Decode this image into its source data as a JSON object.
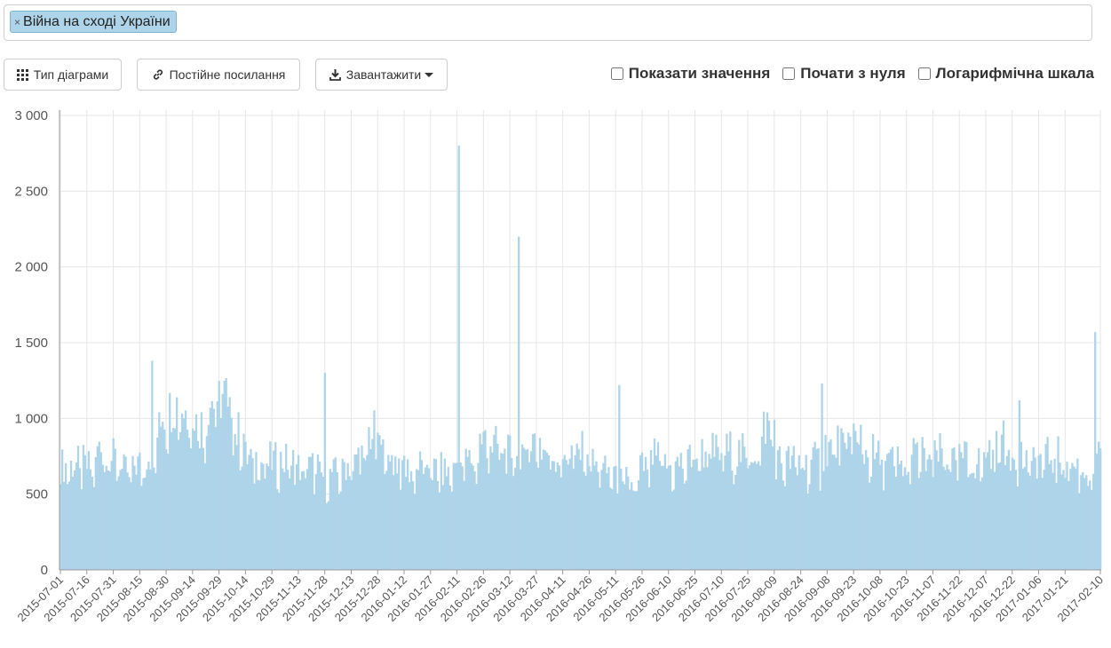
{
  "filter": {
    "tag_label": "Війна на сході України",
    "remove_glyph": "×"
  },
  "toolbar": {
    "chart_type_label": "Тип діаграми",
    "permalink_label": "Постійне посилання",
    "download_label": "Завантажити"
  },
  "options": {
    "show_values_label": "Показати значення",
    "start_zero_label": "Почати з нуля",
    "log_scale_label": "Логарифмічна шкала",
    "show_values_checked": false,
    "start_zero_checked": false,
    "log_scale_checked": false
  },
  "colors": {
    "bar": "#aed4ea",
    "grid": "#e6e6e6",
    "axis": "#999999"
  },
  "chart_data": {
    "type": "bar",
    "title": "",
    "xlabel": "",
    "ylabel": "",
    "ylim": [
      0,
      3000
    ],
    "yticks": [
      0,
      500,
      1000,
      1500,
      2000,
      2500,
      3000
    ],
    "ytick_labels": [
      "0",
      "500",
      "1 000",
      "1 500",
      "2 000",
      "2 500",
      "3 000"
    ],
    "grid": true,
    "legend": "none",
    "start_date": "2015-07-01",
    "end_date": "2017-02-10",
    "xtick_labels": [
      "2015-07-01",
      "2015-07-16",
      "2015-07-31",
      "2015-08-15",
      "2015-08-30",
      "2015-09-14",
      "2015-09-29",
      "2015-10-14",
      "2015-10-29",
      "2015-11-13",
      "2015-11-28",
      "2015-12-13",
      "2015-12-28",
      "2016-01-12",
      "2016-01-27",
      "2016-02-11",
      "2016-02-26",
      "2016-03-12",
      "2016-03-27",
      "2016-04-11",
      "2016-04-26",
      "2016-05-11",
      "2016-05-26",
      "2016-06-10",
      "2016-06-25",
      "2016-07-10",
      "2016-07-25",
      "2016-08-09",
      "2016-08-24",
      "2016-09-08",
      "2016-09-23",
      "2016-10-08",
      "2016-10-23",
      "2016-11-07",
      "2016-11-22",
      "2016-12-07",
      "2016-12-22",
      "2017-01-06",
      "2017-01-21",
      "2017-02-10"
    ],
    "weekly_values": [
      690,
      700,
      680,
      800,
      740,
      650,
      700,
      770,
      1050,
      1100,
      1050,
      960,
      1120,
      1150,
      900,
      740,
      710,
      720,
      720,
      680,
      680,
      620,
      640,
      700,
      760,
      900,
      770,
      720,
      660,
      690,
      660,
      650,
      710,
      730,
      860,
      820,
      760,
      800,
      860,
      790,
      750,
      770,
      780,
      700,
      650,
      590,
      560,
      680,
      740,
      680,
      700,
      760,
      780,
      780,
      790,
      770,
      790,
      960,
      720,
      720,
      700,
      720,
      820,
      830,
      900,
      770,
      740,
      720,
      680,
      760,
      730,
      770,
      720,
      740,
      710,
      800,
      840,
      780,
      710,
      730,
      750,
      720,
      680,
      640,
      720,
      760,
      720,
      710,
      720,
      630,
      560,
      540,
      560,
      560,
      620,
      560,
      570,
      560,
      540,
      530,
      580,
      570,
      580,
      760,
      700,
      600,
      560,
      560,
      560,
      560,
      550,
      540,
      520,
      620,
      620,
      740,
      680,
      660,
      620,
      640,
      640,
      620,
      690,
      700,
      710,
      760,
      790,
      860,
      800,
      860,
      920,
      820,
      620,
      710,
      760,
      870,
      880,
      860,
      840,
      1250,
      960
    ],
    "spikes": [
      {
        "date": "2015-08-22",
        "value": 1380
      },
      {
        "date": "2015-11-28",
        "value": 1300
      },
      {
        "date": "2016-02-12",
        "value": 2800
      },
      {
        "date": "2016-03-17",
        "value": 2200
      },
      {
        "date": "2016-05-13",
        "value": 1220
      },
      {
        "date": "2016-09-05",
        "value": 1230
      },
      {
        "date": "2016-12-26",
        "value": 1120
      },
      {
        "date": "2017-02-07",
        "value": 1570
      }
    ]
  }
}
